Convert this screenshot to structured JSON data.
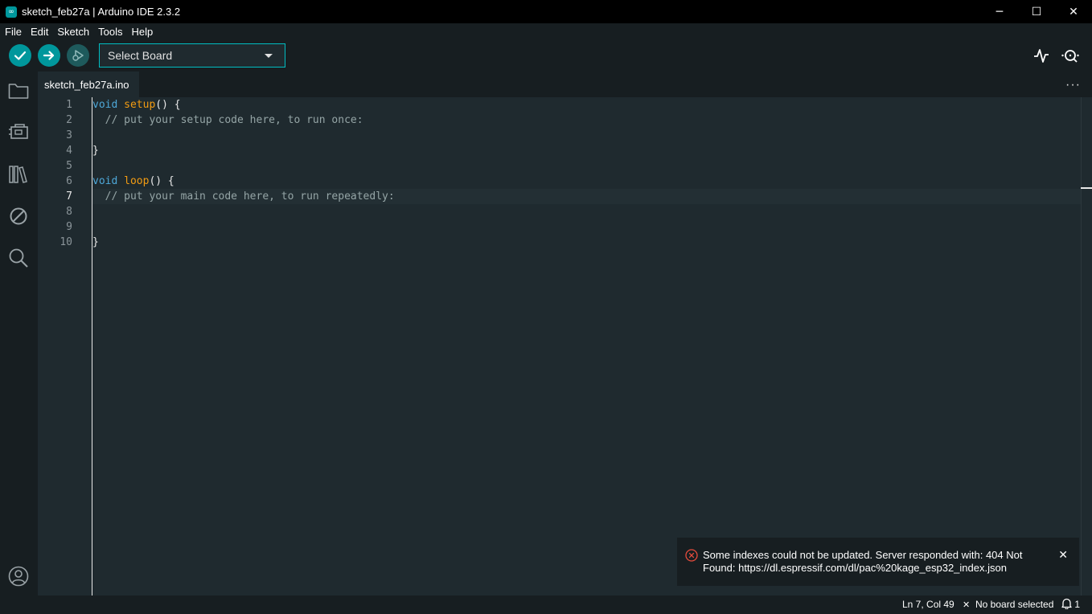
{
  "window": {
    "title": "sketch_feb27a | Arduino IDE 2.3.2",
    "logo_glyph": "∞",
    "minimize_glyph": "─",
    "maximize_glyph": "☐",
    "close_glyph": "✕"
  },
  "menu": {
    "items": [
      "File",
      "Edit",
      "Sketch",
      "Tools",
      "Help"
    ]
  },
  "toolbar": {
    "verify_icon": "check-icon",
    "upload_icon": "arrow-right-icon",
    "debug_icon": "debug-icon",
    "board_selector": "Select Board",
    "serial_plotter_icon": "serial-plotter-icon",
    "serial_monitor_icon": "serial-monitor-icon",
    "accent_color": "#00979c"
  },
  "sidebar": {
    "items": [
      "folder-icon",
      "board-manager-icon",
      "library-manager-icon",
      "debug-disabled-icon",
      "search-icon"
    ],
    "bottom": "account-icon"
  },
  "tabs": {
    "items": [
      {
        "label": "sketch_feb27a.ino"
      }
    ],
    "more_label": "···"
  },
  "editor": {
    "active_line": 7,
    "line_numbers": [
      "1",
      "2",
      "3",
      "4",
      "5",
      "6",
      "7",
      "8",
      "9",
      "10"
    ],
    "lines": {
      "l1": {
        "kw": "void",
        "sp": " ",
        "fn": "setup",
        "rest": "() {"
      },
      "l2": {
        "cm": "  // put your setup code here, to run once:"
      },
      "l4": {
        "rest": "}"
      },
      "l6": {
        "kw": "void",
        "sp": " ",
        "fn": "loop",
        "rest": "() {"
      },
      "l7": {
        "cm": "  // put your main code here, to run repeatedly:"
      },
      "l9": {
        "rest": "}"
      }
    }
  },
  "notification": {
    "icon": "error-circle-icon",
    "message": "Some indexes could not be updated. Server responded with: 404 Not Found: https://dl.espressif.com/dl/pac%20kage_esp32_index.json",
    "close_glyph": "✕",
    "error_color": "#e74c3c"
  },
  "status": {
    "position": "Ln 7, Col 49",
    "board_glyph": "✕",
    "board": "No board selected",
    "notification_count": "1"
  }
}
